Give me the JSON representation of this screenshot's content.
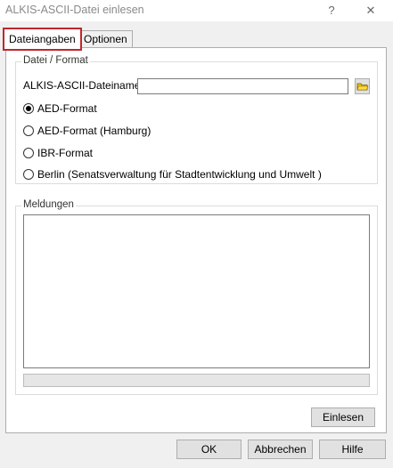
{
  "window": {
    "title": "ALKIS-ASCII-Datei einlesen",
    "help_glyph": "?",
    "close_glyph": "✕"
  },
  "tabs": [
    {
      "label": "Dateiangaben",
      "active": true
    },
    {
      "label": "Optionen",
      "active": false
    }
  ],
  "file_group": {
    "legend": "Datei / Format",
    "filename_label": "ALKIS-ASCII-Dateiname",
    "filename_value": "",
    "formats": [
      {
        "label": "AED-Format",
        "checked": true
      },
      {
        "label": "AED-Format (Hamburg)",
        "checked": false
      },
      {
        "label": "IBR-Format",
        "checked": false
      },
      {
        "label": "Berlin (Senatsverwaltung für Stadtentwicklung und Umwelt )",
        "checked": false
      }
    ]
  },
  "messages_group": {
    "legend": "Meldungen",
    "progress": 0
  },
  "buttons": {
    "read": "Einlesen",
    "ok": "OK",
    "cancel": "Abbrechen",
    "help": "Hilfe"
  },
  "colors": {
    "active_tab_border": "#c0262b",
    "folder_icon": "#f2c200"
  }
}
